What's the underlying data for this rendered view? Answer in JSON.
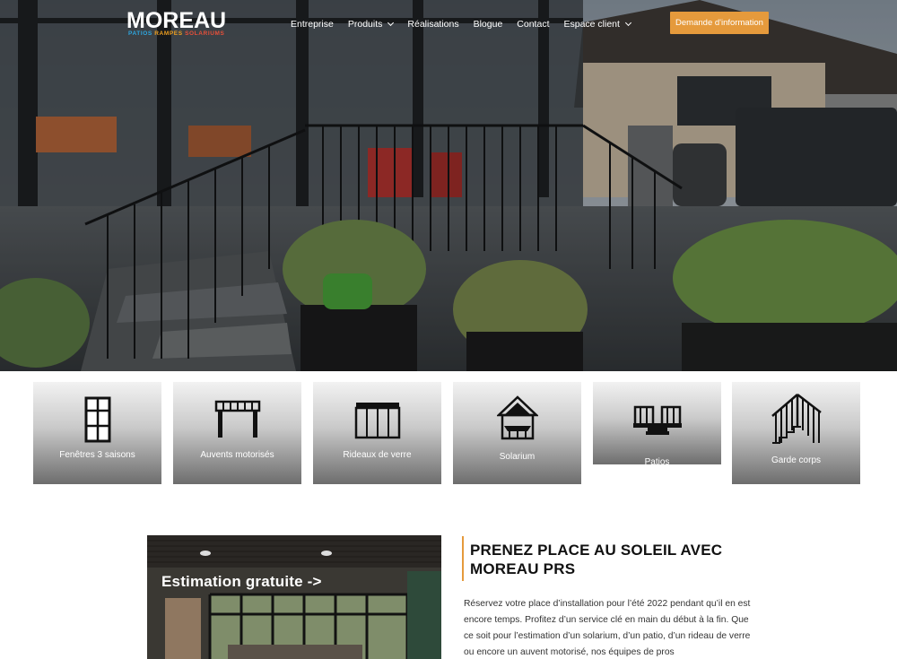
{
  "brand": {
    "logo_word": "MOREAU",
    "logo_sub": [
      "PATIOS",
      "RAMPES",
      "SOLARIUMS"
    ],
    "colors": {
      "blue": "#2ea7e0",
      "orange": "#f0a020",
      "red": "#e9503a"
    }
  },
  "nav": {
    "items": [
      {
        "label": "Entreprise",
        "dropdown": false
      },
      {
        "label": "Produits",
        "dropdown": true
      },
      {
        "label": "Réalisations",
        "dropdown": false
      },
      {
        "label": "Blogue",
        "dropdown": false
      },
      {
        "label": "Contact",
        "dropdown": false
      },
      {
        "label": "Espace client",
        "dropdown": true
      }
    ],
    "cta_label": "Demande d'information",
    "cta_color": "#e59a3c"
  },
  "products": [
    {
      "label": "Fenêtres 3 saisons",
      "icon": "window-icon"
    },
    {
      "label": "Auvents motorisés",
      "icon": "pergola-icon"
    },
    {
      "label": "Rideaux de verre",
      "icon": "glass-curtain-icon"
    },
    {
      "label": "Solarium",
      "icon": "solarium-icon"
    },
    {
      "label": "Patios",
      "icon": "patio-icon"
    },
    {
      "label": "Garde corps",
      "icon": "railing-icon"
    }
  ],
  "promo": {
    "title": "Estimation gratuite ->"
  },
  "section": {
    "title": "PRENEZ PLACE AU SOLEIL AVEC MOREAU PRS",
    "body": "Réservez votre place d’installation pour l’été 2022 pendant qu’il en est encore temps. Profitez d’un service clé en main du début à la fin. Que ce soit pour l’estimation d’un solarium, d’un patio, d’un rideau de verre ou encore un auvent motorisé, nos équipes de pros"
  }
}
